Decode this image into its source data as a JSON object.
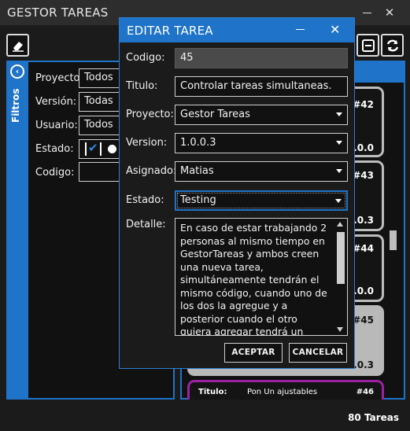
{
  "window": {
    "title": "GESTOR TAREAS",
    "minimize_icon": "minimize-icon",
    "close_icon": "close-icon"
  },
  "filters": {
    "tab_label": "Filtros",
    "rows": [
      {
        "label": "Proyecto:",
        "value": "Todos"
      },
      {
        "label": "Versión:",
        "value": "Todas"
      },
      {
        "label": "Usuario:",
        "value": "Todos"
      },
      {
        "label": "Estado:",
        "value": ""
      },
      {
        "label": "Codigo:",
        "value": ""
      }
    ]
  },
  "cards": [
    {
      "num": "#42",
      "version": "0.0.0"
    },
    {
      "num": "#43",
      "version": "0.0.3"
    },
    {
      "num": "#44",
      "version": "0.0.0"
    },
    {
      "num": "#45",
      "version": "0.0.3"
    },
    {
      "num": "#46",
      "title_label": "Titulo:",
      "title_value": "Pon Un ajustables"
    }
  ],
  "tasks_count": "80 Tareas",
  "dialog": {
    "title": "EDITAR TAREA",
    "fields": {
      "codigo": {
        "label": "Codigo:",
        "value": "45"
      },
      "titulo": {
        "label": "Titulo:",
        "value": "Controlar tareas simultaneas."
      },
      "proyecto": {
        "label": "Proyecto:",
        "value": "Gestor Tareas"
      },
      "version": {
        "label": "Version:",
        "value": "1.0.0.3"
      },
      "asignado": {
        "label": "Asignado:",
        "value": "Matias"
      },
      "estado": {
        "label": "Estado:",
        "value": "Testing"
      },
      "detalle": {
        "label": "Detalle:",
        "value": "En caso de estar trabajando 2 personas al mismo tiempo en GestorTareas y ambos creen una nueva tarea, simultáneamente tendrán el mismo código, cuando uno de los dos la agregue y a posterior cuando el otro quiera agregar tendrá un error debido a que su codigo ya estaría ingresado"
      }
    },
    "accept_label": "ACEPTAR",
    "cancel_label": "CANCELAR"
  },
  "colors": {
    "accent": "#1f73c8",
    "background": "#1b1b1b",
    "card_border": "#bdbdbd",
    "highlight_border": "#9a22a3"
  }
}
